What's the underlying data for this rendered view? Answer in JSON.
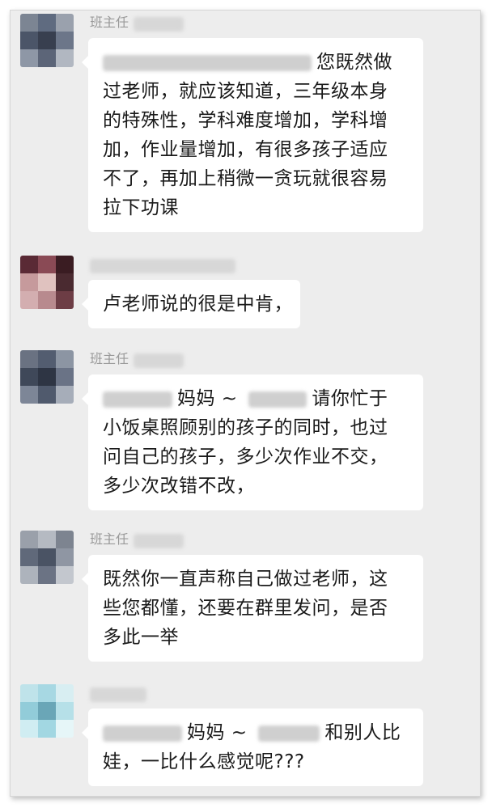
{
  "messages": [
    {
      "sender": "班主任",
      "lines": [
        "您既然做",
        "过老师，就应该知道，三年级本身",
        "的特殊性，学科难度增加，学科增",
        "加，作业量增加，有很多孩子适应",
        "不了，再加上稍微一贪玩就很容易",
        "拉下功课"
      ]
    },
    {
      "sender": "",
      "lines": [
        "卢老师说的很是中肯，"
      ]
    },
    {
      "sender": "班主任",
      "lines": [
        "妈妈 ~",
        "请你忙于",
        "小饭桌照顾别的孩子的同时，也过",
        "问自己的孩子，多少次作业不交，",
        "多少次改错不改，"
      ]
    },
    {
      "sender": "班主任",
      "lines": [
        "既然你一直声称自己做过老师，这",
        "些您都懂，还要在群里发问，是否",
        "多此一举"
      ]
    },
    {
      "sender": "",
      "lines": [
        "妈妈 ~",
        "和别人比",
        "娃，一比什么感觉呢???"
      ]
    }
  ]
}
